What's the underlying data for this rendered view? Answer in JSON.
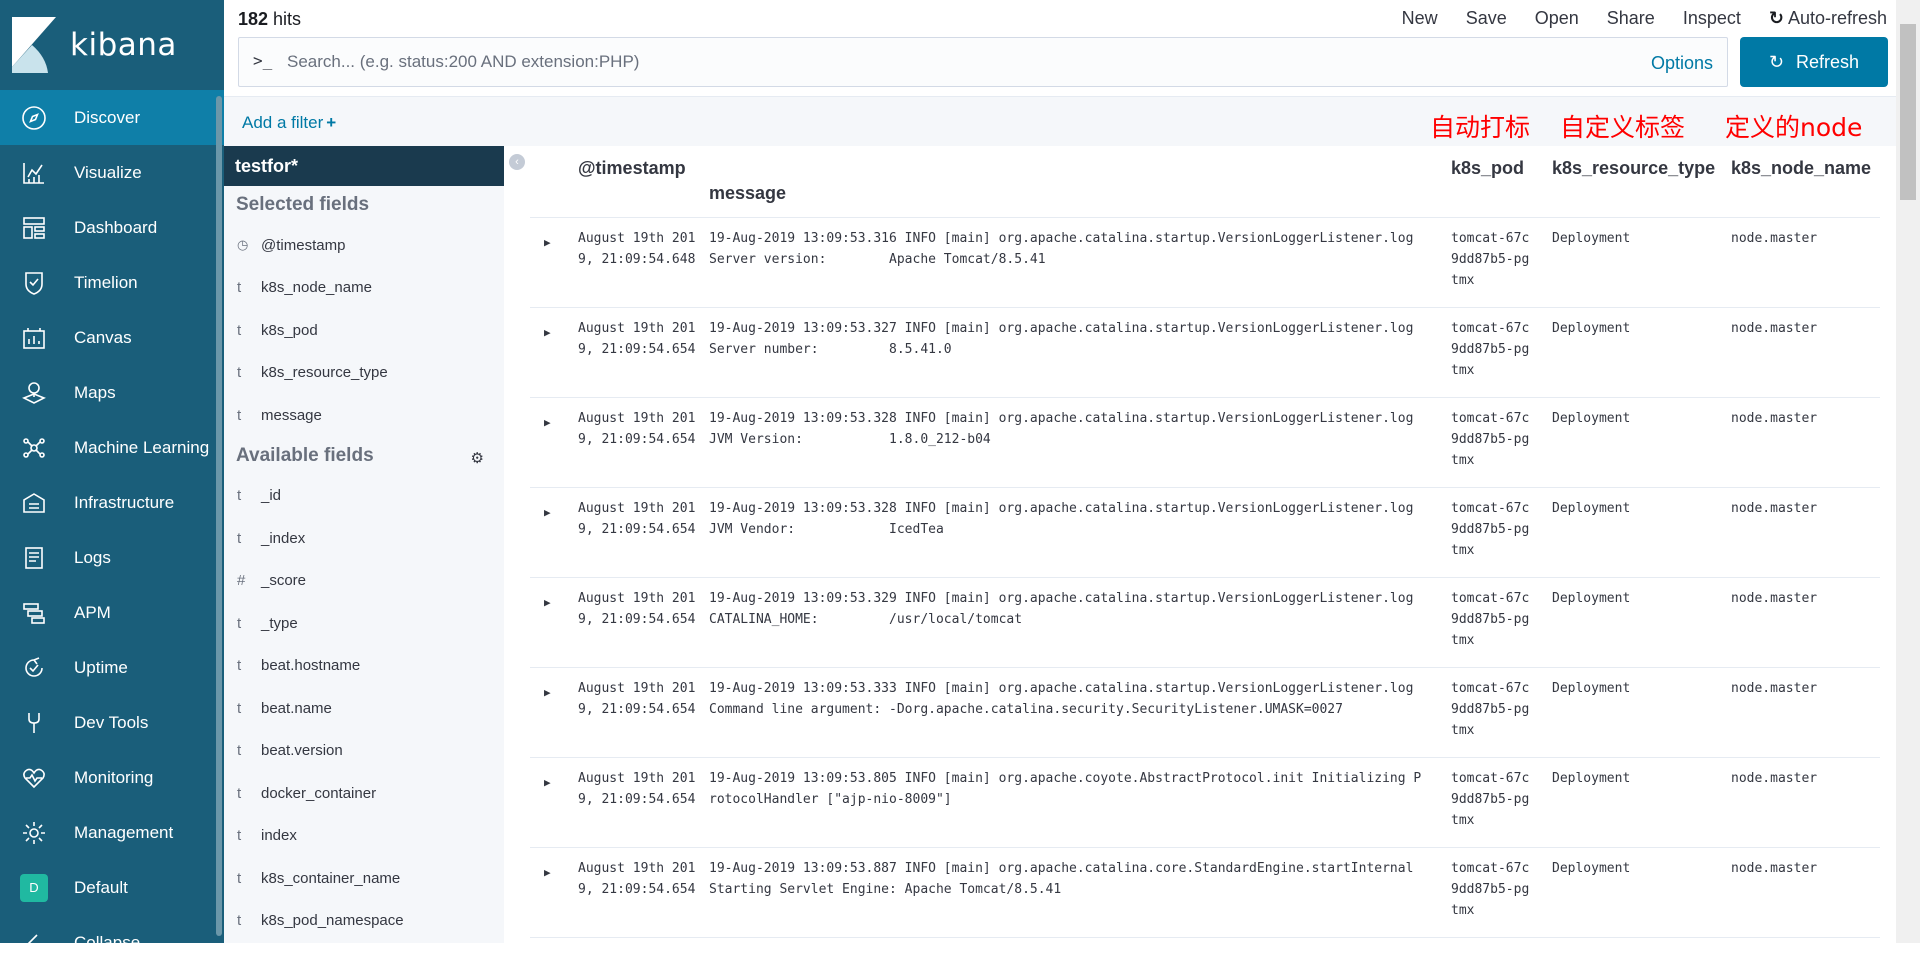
{
  "nav": {
    "brand": "kibana",
    "items": [
      {
        "label": "Discover",
        "icon": "compass-icon",
        "active": true
      },
      {
        "label": "Visualize",
        "icon": "chart-icon"
      },
      {
        "label": "Dashboard",
        "icon": "dashboard-icon"
      },
      {
        "label": "Timelion",
        "icon": "timelion-shield-icon"
      },
      {
        "label": "Canvas",
        "icon": "canvas-icon"
      },
      {
        "label": "Maps",
        "icon": "map-layers-icon"
      },
      {
        "label": "Machine Learning",
        "icon": "machine-learning-icon"
      },
      {
        "label": "Infrastructure",
        "icon": "infrastructure-icon"
      },
      {
        "label": "Logs",
        "icon": "logs-icon"
      },
      {
        "label": "APM",
        "icon": "apm-icon"
      },
      {
        "label": "Uptime",
        "icon": "uptime-icon"
      },
      {
        "label": "Dev Tools",
        "icon": "wrench-icon"
      },
      {
        "label": "Monitoring",
        "icon": "heartbeat-icon"
      },
      {
        "label": "Management",
        "icon": "gear-icon"
      }
    ],
    "space": {
      "badge": "D",
      "label": "Default"
    },
    "collapse_label": "Collapse"
  },
  "top": {
    "hits_count": "182",
    "hits_label": " hits",
    "menu": [
      "New",
      "Save",
      "Open",
      "Share",
      "Inspect"
    ],
    "auto_refresh": "Auto-refresh",
    "search_prompt": ">_",
    "search_placeholder": "Search... (e.g. status:200 AND extension:PHP)",
    "options": "Options",
    "refresh": "Refresh"
  },
  "filter": {
    "add_filter": "Add a filter",
    "annotations": [
      "自动打标",
      "自定义标签",
      "定义的node"
    ]
  },
  "sidebar": {
    "index_pattern": "testfor*",
    "selected_title": "Selected fields",
    "selected": [
      {
        "type": "clock",
        "name": "@timestamp"
      },
      {
        "type": "t",
        "name": "k8s_node_name"
      },
      {
        "type": "t",
        "name": "k8s_pod"
      },
      {
        "type": "t",
        "name": "k8s_resource_type"
      },
      {
        "type": "t",
        "name": "message"
      }
    ],
    "available_title": "Available fields",
    "available": [
      {
        "type": "t",
        "name": "_id"
      },
      {
        "type": "t",
        "name": "_index"
      },
      {
        "type": "#",
        "name": "_score"
      },
      {
        "type": "t",
        "name": "_type"
      },
      {
        "type": "t",
        "name": "beat.hostname"
      },
      {
        "type": "t",
        "name": "beat.name"
      },
      {
        "type": "t",
        "name": "beat.version"
      },
      {
        "type": "t",
        "name": "docker_container"
      },
      {
        "type": "t",
        "name": "index"
      },
      {
        "type": "t",
        "name": "k8s_container_name"
      },
      {
        "type": "t",
        "name": "k8s_pod_namespace"
      }
    ]
  },
  "table": {
    "headers": {
      "timestamp": "@timestamp",
      "message": "message",
      "pod": "k8s_pod",
      "rtype": "k8s_resource_type",
      "node": "k8s_node_name"
    },
    "rows": [
      {
        "ts": "August 19th 2019, 21:09:54.648",
        "msg": "19-Aug-2019 13:09:53.316 INFO [main] org.apache.catalina.startup.VersionLoggerListener.log Server version:        Apache Tomcat/8.5.41",
        "pod": "tomcat-67c9dd87b5-pgtmx",
        "rtype": "Deployment",
        "node": "node.master"
      },
      {
        "ts": "August 19th 2019, 21:09:54.654",
        "msg": "19-Aug-2019 13:09:53.327 INFO [main] org.apache.catalina.startup.VersionLoggerListener.log Server number:         8.5.41.0",
        "pod": "tomcat-67c9dd87b5-pgtmx",
        "rtype": "Deployment",
        "node": "node.master"
      },
      {
        "ts": "August 19th 2019, 21:09:54.654",
        "msg": "19-Aug-2019 13:09:53.328 INFO [main] org.apache.catalina.startup.VersionLoggerListener.log JVM Version:           1.8.0_212-b04",
        "pod": "tomcat-67c9dd87b5-pgtmx",
        "rtype": "Deployment",
        "node": "node.master"
      },
      {
        "ts": "August 19th 2019, 21:09:54.654",
        "msg": "19-Aug-2019 13:09:53.328 INFO [main] org.apache.catalina.startup.VersionLoggerListener.log JVM Vendor:            IcedTea",
        "pod": "tomcat-67c9dd87b5-pgtmx",
        "rtype": "Deployment",
        "node": "node.master"
      },
      {
        "ts": "August 19th 2019, 21:09:54.654",
        "msg": "19-Aug-2019 13:09:53.329 INFO [main] org.apache.catalina.startup.VersionLoggerListener.log CATALINA_HOME:         /usr/local/tomcat",
        "pod": "tomcat-67c9dd87b5-pgtmx",
        "rtype": "Deployment",
        "node": "node.master"
      },
      {
        "ts": "August 19th 2019, 21:09:54.654",
        "msg": "19-Aug-2019 13:09:53.333 INFO [main] org.apache.catalina.startup.VersionLoggerListener.log Command line argument: -Dorg.apache.catalina.security.SecurityListener.UMASK=0027",
        "pod": "tomcat-67c9dd87b5-pgtmx",
        "rtype": "Deployment",
        "node": "node.master"
      },
      {
        "ts": "August 19th 2019, 21:09:54.654",
        "msg": "19-Aug-2019 13:09:53.805 INFO [main] org.apache.coyote.AbstractProtocol.init Initializing ProtocolHandler [\"ajp-nio-8009\"]",
        "pod": "tomcat-67c9dd87b5-pgtmx",
        "rtype": "Deployment",
        "node": "node.master"
      },
      {
        "ts": "August 19th 2019, 21:09:54.654",
        "msg": "19-Aug-2019 13:09:53.887 INFO [main] org.apache.catalina.core.StandardEngine.startInternal Starting Servlet Engine: Apache Tomcat/8.5.41",
        "pod": "tomcat-67c9dd87b5-pgtmx",
        "rtype": "Deployment",
        "node": "node.master"
      }
    ]
  },
  "colors": {
    "nav_bg": "#1a5e7a",
    "nav_active": "#0f7fa8",
    "accent": "#0079a5",
    "annotation": "#ff0000"
  }
}
